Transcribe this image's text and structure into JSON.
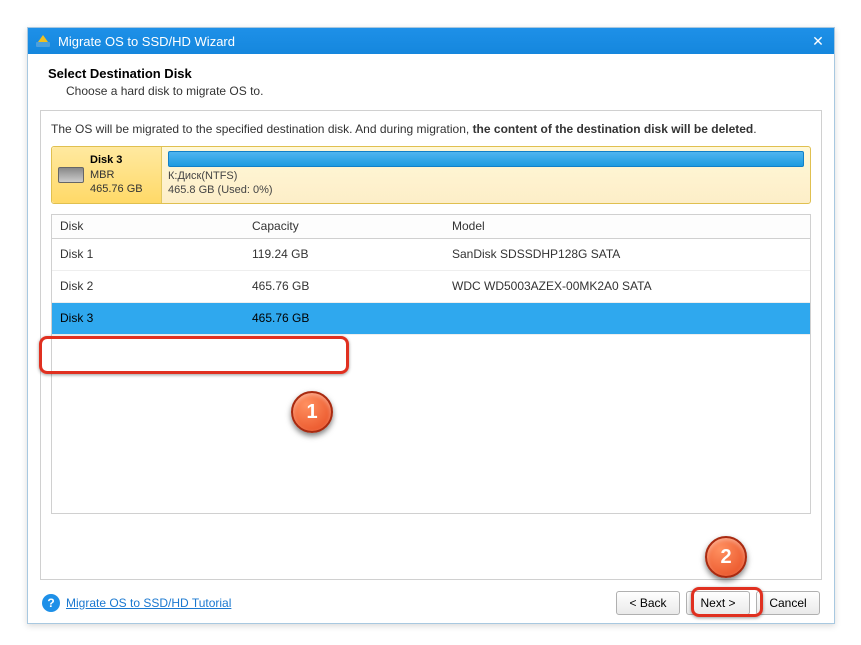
{
  "window": {
    "title": "Migrate OS to SSD/HD Wizard"
  },
  "header": {
    "title": "Select Destination Disk",
    "subtitle": "Choose a hard disk to migrate OS to."
  },
  "warning": {
    "prefix": "The OS will be migrated to the specified destination disk. And during migration, ",
    "bold": "the content of the destination disk will be deleted",
    "suffix": "."
  },
  "selected_disk": {
    "name": "Disk 3",
    "scheme": "MBR",
    "size": "465.76 GB",
    "partition_label": "К:Диск(NTFS)",
    "partition_usage": "465.8 GB (Used: 0%)"
  },
  "table": {
    "columns": {
      "disk": "Disk",
      "capacity": "Capacity",
      "model": "Model"
    },
    "rows": [
      {
        "disk": "Disk 1",
        "capacity": "119.24 GB",
        "model": "SanDisk SDSSDHP128G SATA",
        "selected": false
      },
      {
        "disk": "Disk 2",
        "capacity": "465.76 GB",
        "model": "WDC WD5003AZEX-00MK2A0 SATA",
        "selected": false
      },
      {
        "disk": "Disk 3",
        "capacity": "465.76 GB",
        "model": "",
        "selected": true
      }
    ]
  },
  "footer": {
    "tutorial_link": "Migrate OS to SSD/HD Tutorial",
    "back": "< Back",
    "next": "Next >",
    "cancel": "Cancel"
  },
  "annotations": {
    "marker1": "1",
    "marker2": "2"
  }
}
